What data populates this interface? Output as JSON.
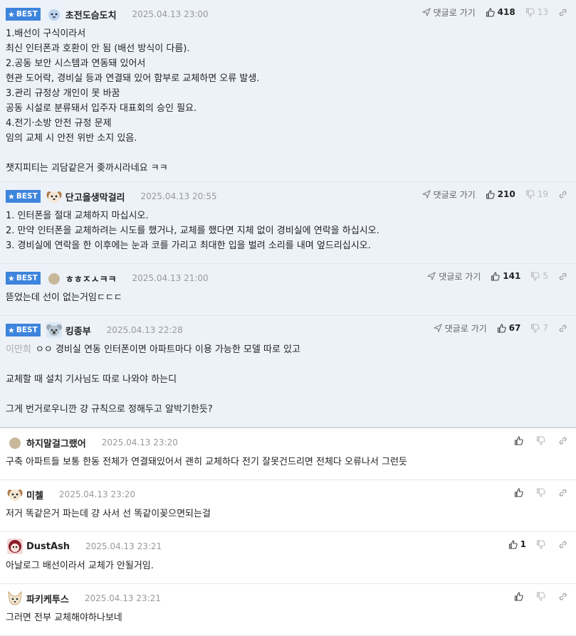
{
  "labels": {
    "best": "BEST",
    "reply": "댓글로 가기"
  },
  "colors": {
    "best_badge": "#3d84dc",
    "best_bg": "#edf2f8"
  },
  "comments": [
    {
      "best": true,
      "nickname": "초전도슴도치",
      "avatar_icon": "hedgehog-icon",
      "date": "2025.04.13 23:00",
      "upvotes": "418",
      "downvotes": "13",
      "lines": [
        "1.배선이 구식이라서",
        "최신 인터폰과 호환이 안 됨 (배선 방식이 다름).",
        "2.공동 보안 시스템과 연동돼 있어서",
        "현관 도어락, 경비실 등과 연결돼 있어 함부로 교체하면 오류 발생.",
        "3.관리 규정상 개인이 못 바꿈",
        "공동 시설로 분류돼서 입주자 대표회의 승인 필요.",
        "4.전기·소방 안전 규정 문제",
        "임의 교체 시 안전 위반 소지 있음.",
        "",
        "챗지피티는 괴담같은거 좆까시라네요 ㅋㅋ"
      ]
    },
    {
      "best": true,
      "nickname": "단고을생막걸리",
      "avatar_icon": "puppy-icon",
      "date": "2025.04.13 20:55",
      "upvotes": "210",
      "downvotes": "19",
      "lines": [
        "1. 인터폰을 절대 교체하지 마십시오.",
        "2. 만약 인터폰을 교체하려는 시도를 했거나, 교체를 했다면 지체 없이 경비실에 연락을 하십시오.",
        "3. 경비실에 연락을 한 이후에는 눈과 코를 가리고 최대한 입을 벌려 소리를 내며 엎드리십시오."
      ]
    },
    {
      "best": true,
      "nickname": "ㅎㅎㅈㅅㅋㅋ",
      "avatar_icon": "default-avatar-icon",
      "date": "2025.04.13 21:00",
      "upvotes": "141",
      "downvotes": "5",
      "lines": [
        "뜯었는데 선이 없는거임ㄷㄷㄷ"
      ]
    },
    {
      "best": true,
      "nickname": "킹종부",
      "avatar_icon": "koala-icon",
      "date": "2025.04.13 22:28",
      "upvotes": "67",
      "downvotes": "7",
      "mention": "이만희",
      "lines": [
        "ㅇㅇ 경비실 연동 인터폰이면 아파트마다 이용 가능한 모델 따로 있고",
        "",
        "교체할 때 설치 기사님도 따로 나와야 하는디",
        "",
        "그게 번거로우니깐 걍 규칙으로 정해두고 알박기한듯?"
      ]
    },
    {
      "best": false,
      "nickname": "하지말걸그랬어",
      "avatar_icon": "default-avatar-icon",
      "date": "2025.04.13 23:20",
      "upvotes": "",
      "lines": [
        "구축 아파트들 보통 한동 전체가 연결돼있어서 괜히 교체하다 전기 잘못건드리면 전체다 오류나서 그런듯"
      ]
    },
    {
      "best": false,
      "nickname": "미첼",
      "avatar_icon": "puppy-icon",
      "date": "2025.04.13 23:20",
      "upvotes": "",
      "lines": [
        "저거 똑같은거 파는데 걍 사서 선 똑같이꽂으면되는걸"
      ]
    },
    {
      "best": false,
      "nickname": "DustAsh",
      "avatar_icon": "character-avatar-icon",
      "date": "2025.04.13 23:21",
      "upvotes": "1",
      "lines": [
        "아날로그 배선이라서 교체가 안될거임."
      ]
    },
    {
      "best": false,
      "nickname": "파키케투스",
      "avatar_icon": "fox-icon",
      "date": "2025.04.13 23:21",
      "upvotes": "",
      "lines": [
        "그러면 전부 교체해야하나보네"
      ]
    }
  ]
}
